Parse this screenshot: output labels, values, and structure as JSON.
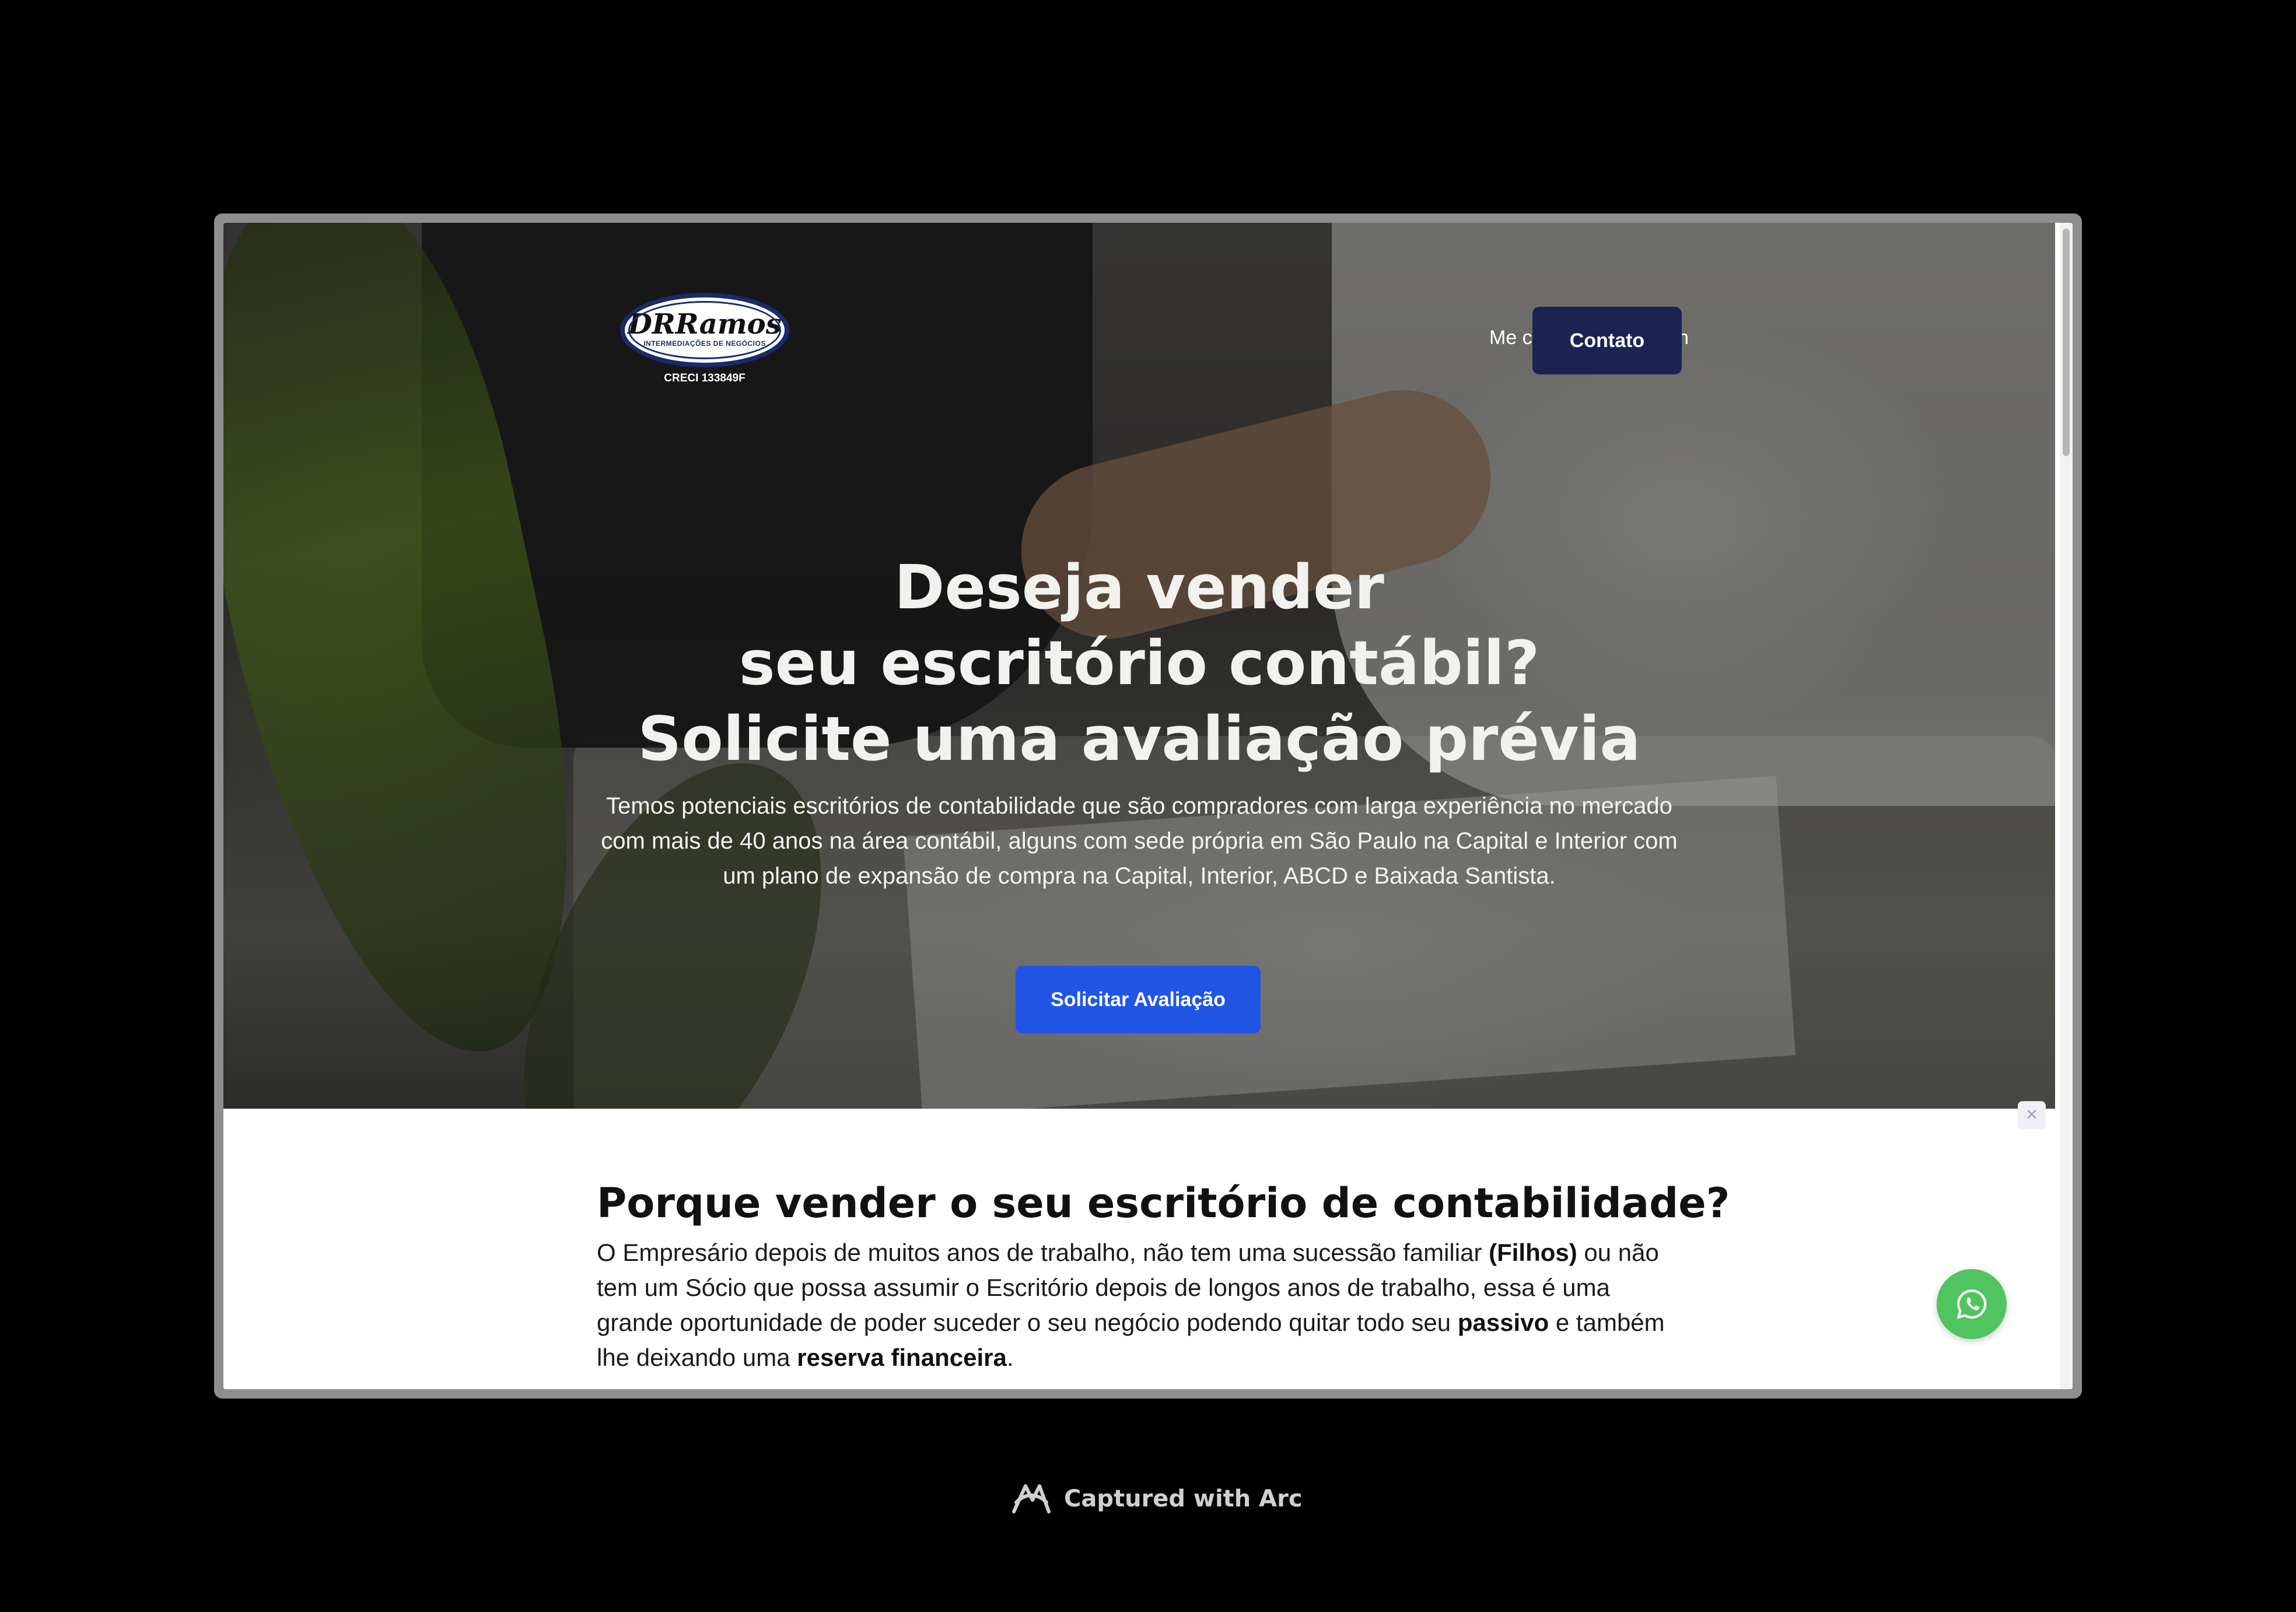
{
  "header": {
    "logo_name": "DRRamos",
    "logo_tagline": "INTERMEDIAÇÕES DE NEGÓCIOS",
    "logo_creci": "CRECI 133849F",
    "nav_linkedin": "Me chame no Linkedin",
    "contact_button": "Contato"
  },
  "hero": {
    "title_line1": "Deseja vender",
    "title_line2": "seu escritório contábil?",
    "title_line3": "Solicite uma avaliação prévia",
    "description": "Temos potenciais escritórios de contabilidade que são compradores com larga experiência no mercado com mais de 40 anos na área contábil, alguns com sede própria em São Paulo na Capital e Interior com um plano de expansão de compra na Capital, Interior, ABCD e Baixada Santista.",
    "cta_button": "Solicitar Avaliação"
  },
  "section": {
    "title": "Porque vender o seu escritório de contabilidade?",
    "text_part1": "O Empresário depois de muitos anos de trabalho, não tem uma sucessão familiar ",
    "text_bold1": "(Filhos)",
    "text_part2": " ou não tem um Sócio que possa assumir o Escritório depois de longos anos de trabalho, essa é uma grande oportunidade de poder suceder o seu negócio podendo quitar todo seu ",
    "text_bold2": "passivo",
    "text_part3": " e também lhe deixando uma ",
    "text_bold3": "reserva financeira",
    "text_part4": "."
  },
  "widgets": {
    "whatsapp_icon": "whatsapp-icon",
    "whatsapp_color": "#4fc45f"
  },
  "footer": {
    "capture_label": "Captured with Arc"
  },
  "colors": {
    "contact_button": "#1b2353",
    "cta_button": "#2055e6",
    "background": "#000000"
  }
}
